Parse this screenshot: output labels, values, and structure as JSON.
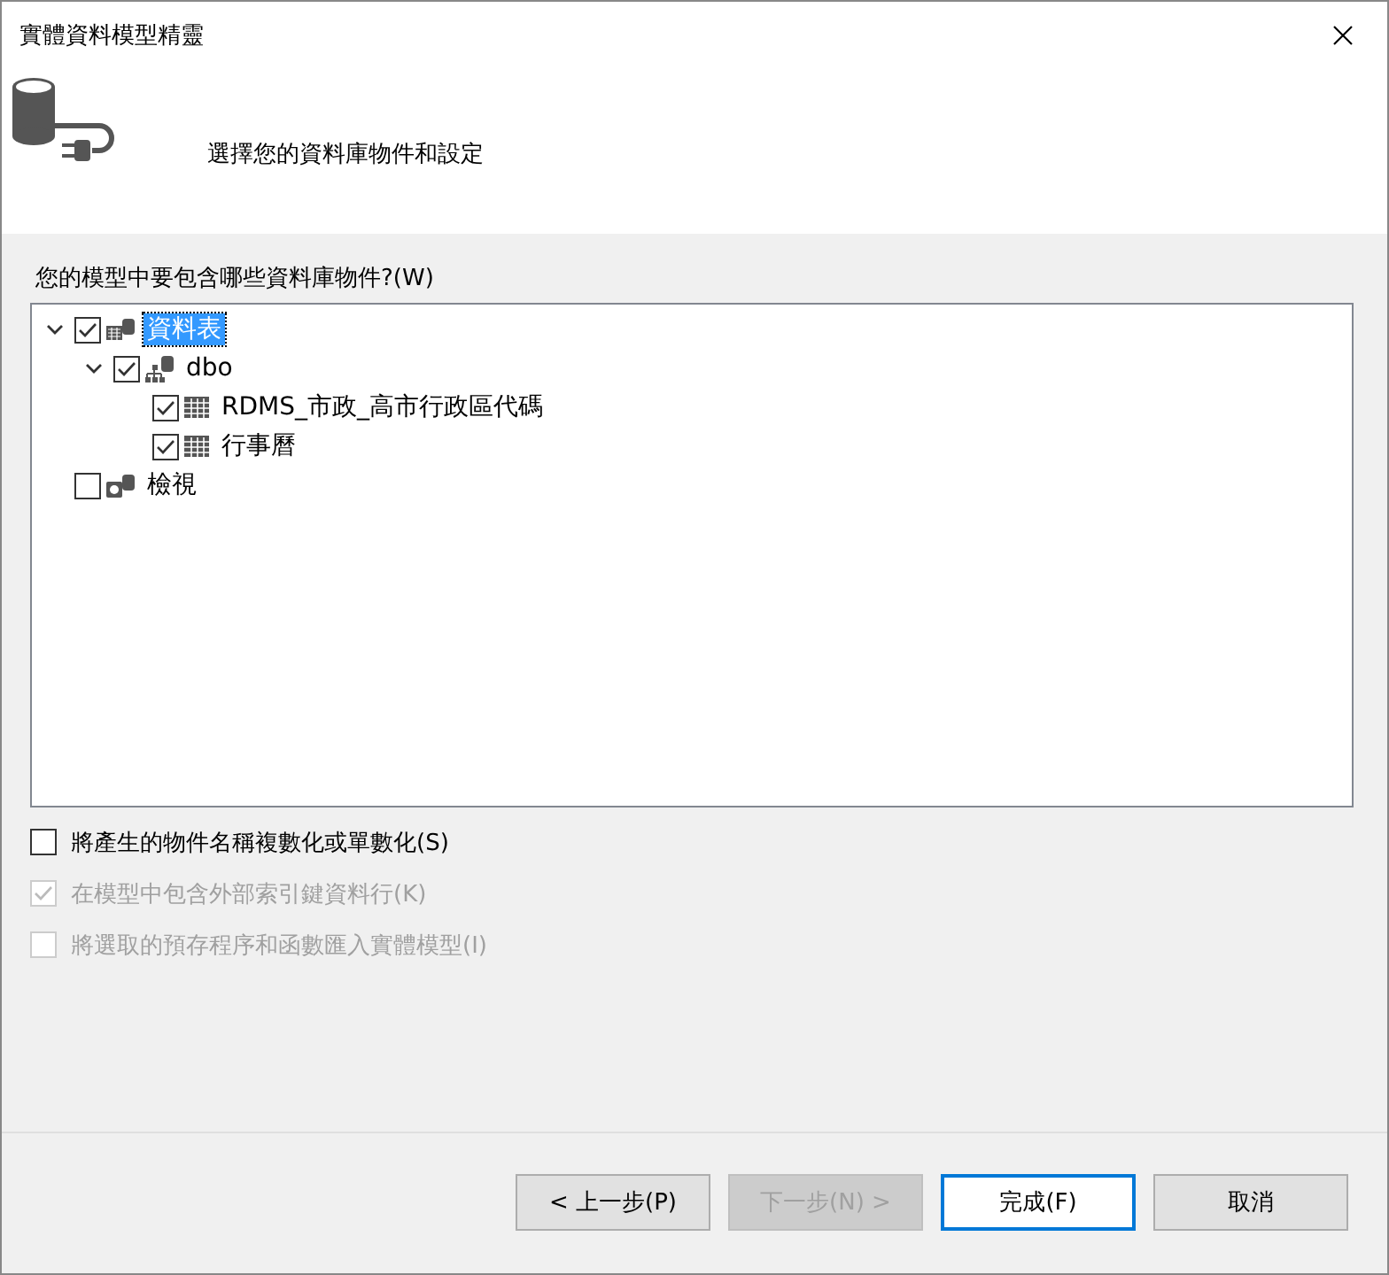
{
  "window": {
    "title": "實體資料模型精靈"
  },
  "header": {
    "subtitle": "選擇您的資料庫物件和設定"
  },
  "tree_label": "您的模型中要包含哪些資料庫物件?(W)",
  "tree": [
    {
      "label": "資料表",
      "kind": "tables",
      "checked": true,
      "expanded": true,
      "selected": true,
      "children": [
        {
          "label": "dbo",
          "kind": "schema",
          "checked": true,
          "expanded": true,
          "selected": false,
          "children": [
            {
              "label": "RDMS_市政_高市行政區代碼",
              "kind": "table",
              "checked": true,
              "selected": false
            },
            {
              "label": "行事曆",
              "kind": "table",
              "checked": true,
              "selected": false
            }
          ]
        }
      ]
    },
    {
      "label": "檢視",
      "kind": "views",
      "checked": false,
      "selected": false
    }
  ],
  "options": [
    {
      "label": "將產生的物件名稱複數化或單數化(S)",
      "checked": false,
      "disabled": false
    },
    {
      "label": "在模型中包含外部索引鍵資料行(K)",
      "checked": true,
      "disabled": true
    },
    {
      "label": "將選取的預存程序和函數匯入實體模型(I)",
      "checked": false,
      "disabled": true
    }
  ],
  "buttons": [
    {
      "label": "< 上一步(P)",
      "disabled": false,
      "default": false
    },
    {
      "label": "下一步(N) >",
      "disabled": true,
      "default": false
    },
    {
      "label": "完成(F)",
      "disabled": false,
      "default": true
    },
    {
      "label": "取消",
      "disabled": false,
      "default": false
    }
  ]
}
